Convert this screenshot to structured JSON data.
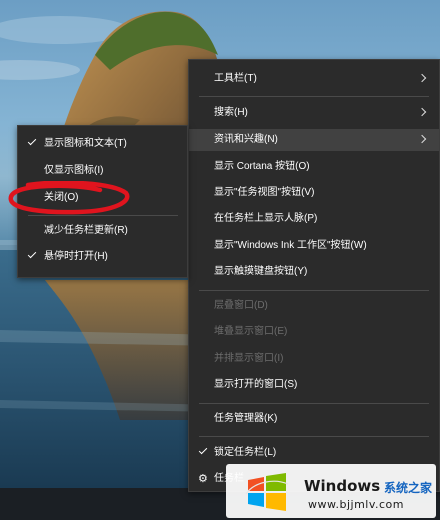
{
  "desktop": {
    "wallpaper": "coastal-rock-sunset"
  },
  "taskbar_menu": {
    "items": [
      {
        "label": "工具栏(T)",
        "submenu": true
      },
      {
        "label": "搜索(H)",
        "submenu": true
      },
      {
        "label": "资讯和兴趣(N)",
        "submenu": true,
        "highlighted": true
      },
      {
        "label": "显示 Cortana 按钮(O)"
      },
      {
        "label": "显示\"任务视图\"按钮(V)"
      },
      {
        "label": "在任务栏上显示人脉(P)"
      },
      {
        "label": "显示\"Windows Ink 工作区\"按钮(W)"
      },
      {
        "label": "显示触摸键盘按钮(Y)"
      },
      {
        "label": "层叠窗口(D)",
        "disabled": true
      },
      {
        "label": "堆叠显示窗口(E)",
        "disabled": true
      },
      {
        "label": "并排显示窗口(I)",
        "disabled": true
      },
      {
        "label": "显示打开的窗口(S)"
      },
      {
        "label": "任务管理器(K)"
      },
      {
        "label": "锁定任务栏(L)",
        "checked": true
      },
      {
        "label": "任务栏",
        "icon": "gear-icon",
        "partially_hidden": true
      }
    ]
  },
  "news_submenu": {
    "items": [
      {
        "label": "显示图标和文本(T)",
        "checked": true
      },
      {
        "label": "仅显示图标(I)"
      },
      {
        "label": "关闭(O)",
        "annotated": true
      },
      {
        "label": "减少任务栏更新(R)"
      },
      {
        "label": "悬停时打开(H)",
        "checked": true
      }
    ]
  },
  "annotation": {
    "color": "#e0141e"
  },
  "watermark": {
    "brand": "Windows",
    "name": "系统之家",
    "url": "www.bjjmlv.com"
  },
  "colors": {
    "menu_bg": "#2b2b2b",
    "menu_hover": "#414141",
    "disabled_text": "#6d6d6d",
    "taskbar": "#1b1f24"
  }
}
